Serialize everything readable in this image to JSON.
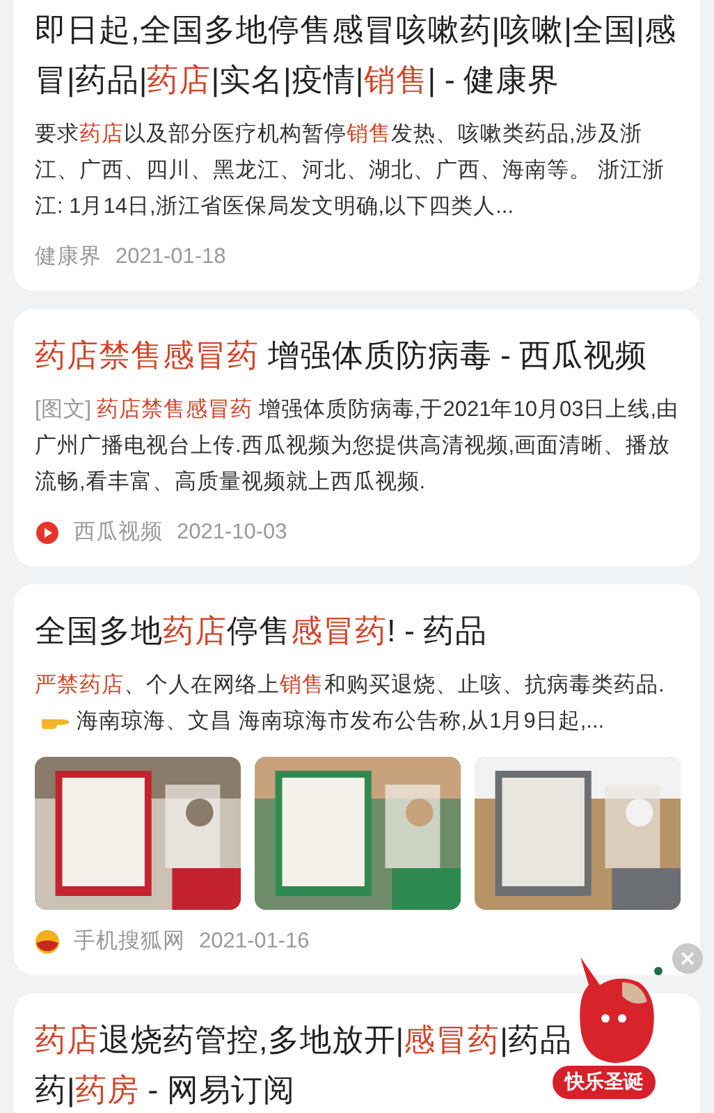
{
  "results": [
    {
      "title": "即日起,全国多地停售感冒咳嗽药|咳嗽|全国|感冒|药品|**药店**|实名|疫情|**销售**| - 健康界",
      "snippet": "要求**药店**以及部分医疗机构暂停**销售**发热、咳嗽类药品,涉及浙江、广西、四川、黑龙江、河北、湖北、广西、海南等。 浙江浙江: 1月14日,浙江省医保局发文明确,以下四类人...",
      "source": {
        "name": "健康界",
        "kind": "none"
      },
      "date": "2021-01-18"
    },
    {
      "title": "**药店禁售感冒药** 增强体质防病毒 - 西瓜视频",
      "tag": "[图文]",
      "snippet": "**药店禁售感冒药** 增强体质防病毒,于2021年10月03日上线,由广州广播电视台上传.西瓜视频为您提供高清视频,画面清晰、播放流畅,看丰富、高质量视频就上西瓜视频.",
      "source": {
        "name": "西瓜视频",
        "kind": "play"
      },
      "date": "2021-10-03"
    },
    {
      "title": "全国多地**药店**停售**感冒药**! - 药品",
      "snippet": "**严禁药店**、个人在网络上**销售**和购买退烧、止咳、抗病毒类药品.",
      "snippet_after": "海南琼海、文昌 海南琼海市发布公告称,从1月9日起,...",
      "source": {
        "name": "手机搜狐网",
        "kind": "fox"
      },
      "date": "2021-01-16"
    },
    {
      "title_lines": [
        "**药店**退烧药管控,多地放开|**感冒药**|药品",
        "药|**药房** - 网易订阅"
      ]
    }
  ],
  "promo": {
    "label": "快乐圣诞"
  }
}
